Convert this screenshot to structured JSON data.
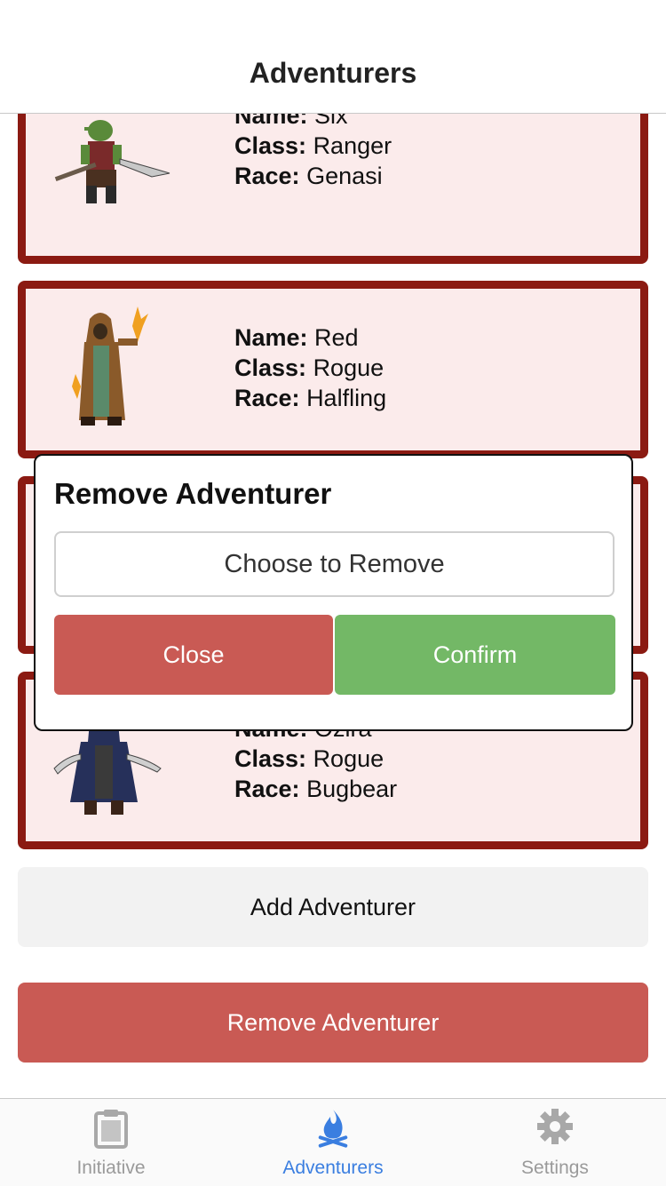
{
  "header": {
    "title": "Adventurers"
  },
  "adventurers": [
    {
      "name_label": "Name:",
      "name": "Six",
      "class_label": "Class:",
      "class": "Ranger",
      "race_label": "Race:",
      "race": "Genasi",
      "sprite": "goblin-ranger"
    },
    {
      "name_label": "Name:",
      "name": "Red",
      "class_label": "Class:",
      "class": "Rogue",
      "race_label": "Race:",
      "race": "Halfling",
      "sprite": "hooded-mage"
    },
    {
      "name_label": "Name:",
      "name": "Ozira",
      "class_label": "Class:",
      "class": "Rogue",
      "race_label": "Race:",
      "race": "Bugbear",
      "sprite": "cloaked-rogue"
    }
  ],
  "actions": {
    "add_label": "Add Adventurer",
    "remove_label": "Remove Adventurer"
  },
  "modal": {
    "title": "Remove Adventurer",
    "select_placeholder": "Choose to Remove",
    "close_label": "Close",
    "confirm_label": "Confirm"
  },
  "tabs": [
    {
      "label": "Initiative",
      "icon": "clipboard-icon",
      "active": false
    },
    {
      "label": "Adventurers",
      "icon": "campfire-icon",
      "active": true
    },
    {
      "label": "Settings",
      "icon": "gear-icon",
      "active": false
    }
  ],
  "colors": {
    "accent": "#3a7ee0",
    "card_border": "#8b1a12",
    "card_bg": "#fbebeb",
    "danger": "#c95a54",
    "success": "#73b866"
  }
}
